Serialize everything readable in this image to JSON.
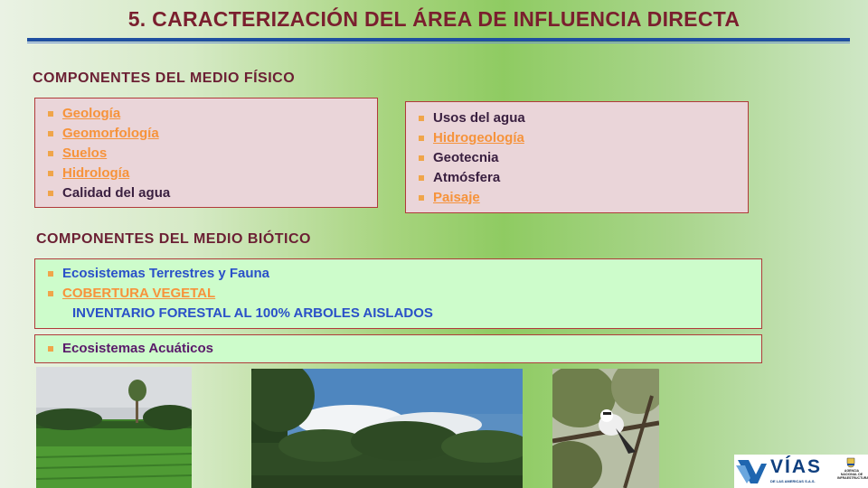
{
  "slide": {
    "title": "5. CARACTERIZACIÓN DEL ÁREA DE INFLUENCIA DIRECTA",
    "fisico": {
      "heading": "COMPONENTES DEL MEDIO FÍSICO",
      "left_items": [
        "Geología",
        "Geomorfología",
        "Suelos",
        "Hidrología",
        "Calidad del agua"
      ],
      "right_items": [
        "Usos del agua",
        "Hidrogeología",
        "Geotecnia",
        "Atmósfera",
        "Paisaje"
      ]
    },
    "biotico": {
      "heading": "COMPONENTES DEL MEDIO BIÓTICO",
      "items": [
        "Ecosistemas Terrestres y Fauna",
        "COBERTURA VEGETAL"
      ],
      "note": "INVENTARIO FORESTAL AL 100% ARBOLES AISLADOS",
      "aquatic": "Ecosistemas Acuáticos"
    },
    "logo": {
      "brand": "VÍAS",
      "brand_sub": "DE LAS AMERICAS S.A.S.",
      "agency": "AGENCIA NACIONAL DE INFRAESTRUCTURA"
    },
    "colors": {
      "title": "#7a1f2e",
      "link": "#f6933b",
      "rule": "#1f4fa0"
    }
  }
}
